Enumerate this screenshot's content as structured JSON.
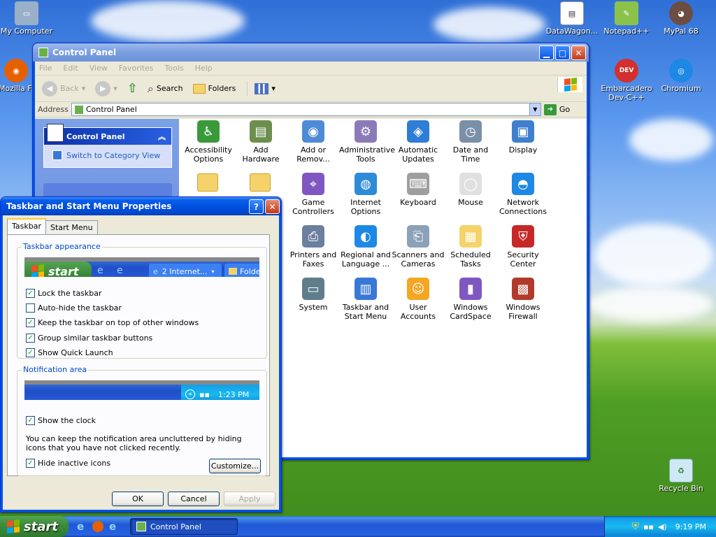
{
  "desktop": {
    "icons": [
      {
        "label": "My Computer",
        "icon": "computer-icon"
      },
      {
        "label": "Mozilla Fi",
        "icon": "firefox-icon"
      },
      {
        "label": "DataWagon...",
        "icon": "datawagon-icon"
      },
      {
        "label": "Notepad++",
        "icon": "notepadpp-icon"
      },
      {
        "label": "MyPal 68",
        "icon": "mypal-icon"
      },
      {
        "label": "Embarcadero Dev-C++",
        "icon": "devcpp-icon",
        "badge": "DEV"
      },
      {
        "label": "Chromium",
        "icon": "chromium-icon"
      },
      {
        "label": "Recycle Bin",
        "icon": "recycle-bin-icon"
      }
    ]
  },
  "control_panel": {
    "title": "Control Panel",
    "menu": [
      "File",
      "Edit",
      "View",
      "Favorites",
      "Tools",
      "Help"
    ],
    "toolbar": {
      "back": "Back",
      "search": "Search",
      "folders": "Folders"
    },
    "address": {
      "label": "Address",
      "value": "Control Panel",
      "go": "Go"
    },
    "taskpane": {
      "header": "Control Panel",
      "link": "Switch to Category View"
    },
    "items": [
      {
        "label": "Accessibility Options",
        "icon": "accessibility-icon"
      },
      {
        "label": "Add Hardware",
        "icon": "add-hardware-icon"
      },
      {
        "label": "Add or Remov...",
        "icon": "add-remove-programs-icon"
      },
      {
        "label": "Administrative Tools",
        "icon": "admin-tools-icon"
      },
      {
        "label": "Automatic Updates",
        "icon": "automatic-updates-icon"
      },
      {
        "label": "Date and Time",
        "icon": "date-time-icon"
      },
      {
        "label": "Display",
        "icon": "display-icon"
      },
      {
        "label": "Game Controllers",
        "icon": "game-controllers-icon"
      },
      {
        "label": "Internet Options",
        "icon": "internet-options-icon"
      },
      {
        "label": "Keyboard",
        "icon": "keyboard-icon"
      },
      {
        "label": "Mouse",
        "icon": "mouse-icon"
      },
      {
        "label": "Network Connections",
        "icon": "network-connections-icon"
      },
      {
        "label": "Printers and Faxes",
        "icon": "printers-icon"
      },
      {
        "label": "Regional and Language ...",
        "icon": "regional-icon"
      },
      {
        "label": "Scanners and Cameras",
        "icon": "scanners-icon"
      },
      {
        "label": "Scheduled Tasks",
        "icon": "scheduled-tasks-icon"
      },
      {
        "label": "Security Center",
        "icon": "security-center-icon"
      },
      {
        "label": "System",
        "icon": "system-icon"
      },
      {
        "label": "Taskbar and Start Menu",
        "icon": "taskbar-start-menu-icon"
      },
      {
        "label": "User Accounts",
        "icon": "user-accounts-icon"
      },
      {
        "label": "Windows CardSpace",
        "icon": "cardspace-icon"
      },
      {
        "label": "Windows Firewall",
        "icon": "firewall-icon"
      }
    ]
  },
  "dialog": {
    "title": "Taskbar and Start Menu Properties",
    "tabs": [
      "Taskbar",
      "Start Menu"
    ],
    "appearance": {
      "label": "Taskbar appearance",
      "preview": {
        "start": "start",
        "button1": "2 Internet...",
        "button2": "Folde"
      },
      "options": [
        {
          "label": "Lock the taskbar",
          "checked": true
        },
        {
          "label": "Auto-hide the taskbar",
          "checked": false
        },
        {
          "label": "Keep the taskbar on top of other windows",
          "checked": true
        },
        {
          "label": "Group similar taskbar buttons",
          "checked": true
        },
        {
          "label": "Show Quick Launch",
          "checked": true
        }
      ]
    },
    "notification": {
      "label": "Notification area",
      "preview_time": "1:23 PM",
      "show_clock": {
        "label": "Show the clock",
        "checked": true
      },
      "description": "You can keep the notification area uncluttered by hiding icons that you have not clicked recently.",
      "hide_inactive": {
        "label": "Hide inactive icons",
        "checked": true
      },
      "customize": "Customize..."
    },
    "buttons": {
      "ok": "OK",
      "cancel": "Cancel",
      "apply": "Apply"
    }
  },
  "taskbar": {
    "start": "start",
    "task": "Control Panel",
    "clock": "9:19 PM"
  }
}
